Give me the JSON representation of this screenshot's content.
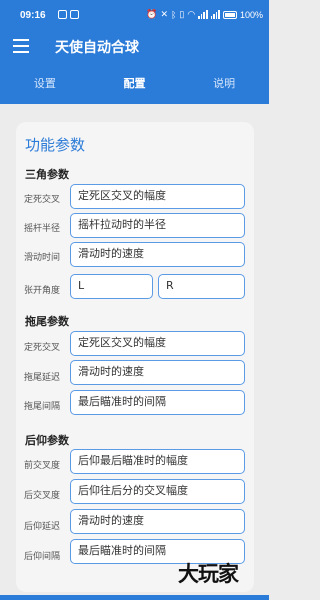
{
  "status_bar": {
    "time": "09:16",
    "battery": "100%",
    "icons": [
      "alarm-icon",
      "mute-icon",
      "bluetooth-icon",
      "vibrate-icon",
      "wifi-icon",
      "signal-icon",
      "signal-icon",
      "battery-icon"
    ]
  },
  "app_bar": {
    "title": "天使自动合球",
    "menu_icon": "menu-icon"
  },
  "tabs": [
    {
      "label": "设置",
      "active": false
    },
    {
      "label": "配置",
      "active": true
    },
    {
      "label": "说明",
      "active": false
    }
  ],
  "card": {
    "title": "功能参数",
    "triangle": {
      "title": "三角参数",
      "rows": [
        {
          "label": "定死交叉",
          "value": "定死区交叉的幅度"
        },
        {
          "label": "摇杆半径",
          "value": "摇杆拉动时的半径"
        },
        {
          "label": "滑动时间",
          "value": "滑动时的速度"
        }
      ],
      "angle": {
        "label": "张开角度",
        "left": "L",
        "right": "R"
      }
    },
    "tail": {
      "title": "拖尾参数",
      "rows": [
        {
          "label": "定死交叉",
          "value": "定死区交叉的幅度"
        },
        {
          "label": "拖尾延迟",
          "value": "滑动时的速度"
        },
        {
          "label": "拖尾间隔",
          "value": "最后瞄准时的间隔"
        }
      ]
    },
    "back": {
      "title": "后仰参数",
      "rows": [
        {
          "label": "前交叉度",
          "value": "后仰最后瞄准时的幅度"
        },
        {
          "label": "后交叉度",
          "value": "后仰往后分的交叉幅度"
        },
        {
          "label": "后仰延迟",
          "value": "滑动时的速度"
        },
        {
          "label": "后仰间隔",
          "value": "最后瞄准时的间隔"
        }
      ]
    }
  },
  "watermark": "大玩家",
  "colors": {
    "primary": "#2b7bd8",
    "field_border": "#5b9be6",
    "card_bg": "#f5f5f5"
  }
}
